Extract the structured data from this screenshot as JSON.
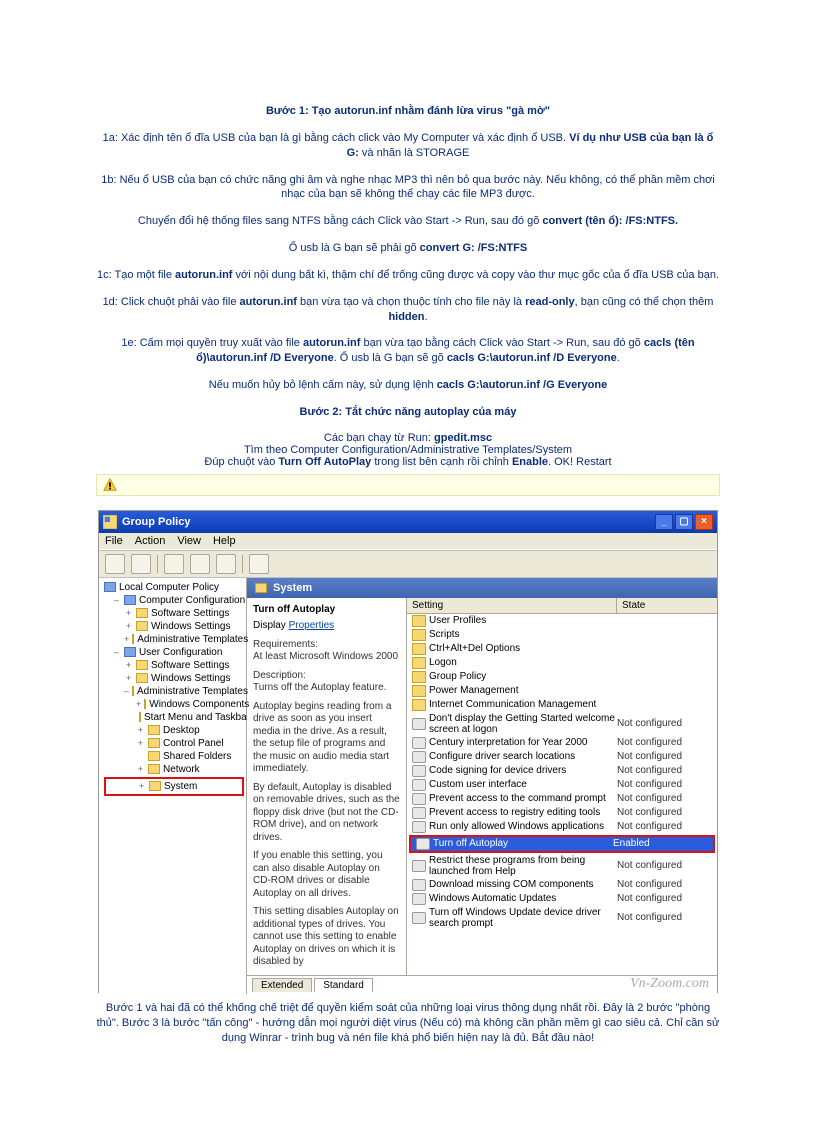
{
  "step1": {
    "heading": "Bước 1: Tạo autorun.inf nhằm đánh lừa virus \"gà mờ\"",
    "p1a_pre": "1a: Xác định tên ổ đĩa USB của bạn là gì bằng cách click vào My Computer và xác định ổ USB. ",
    "p1a_bold1": "Ví dụ như USB của bạn là ổ G:",
    "p1a_post": " và nhãn là STORAGE",
    "p1b": "1b: Nếu ổ USB của bạn có chức năng ghi âm và nghe nhạc MP3 thì nên bỏ qua bước này. Nếu không, có thể phần mềm chơi nhạc của bạn sẽ không thể chạy các file MP3 được.",
    "p1conv_pre": "Chuyển đổi hệ thống files sang NTFS bằng cách Click vào Start -> Run, sau đó gõ ",
    "p1conv_bold": "convert (tên ổ): /FS:NTFS.",
    "p1g_pre": "Ổ usb là G bạn sẽ phải gõ ",
    "p1g_bold": "convert G: /FS:NTFS",
    "p1c_pre": "1c: Tạo một file ",
    "p1c_b1": "autorun.inf",
    "p1c_mid": " với nội dung bất kì, thậm chí để trống cũng được và copy vào thư mục gốc của ổ đĩa USB của bạn.",
    "p1d_pre": "1d: Click chuột phải vào file ",
    "p1d_b1": "autorun.inf",
    "p1d_mid": " bạn vừa tạo và chọn thuộc tính cho file này là ",
    "p1d_b2": "read-only",
    "p1d_mid2": ", bạn cũng có thể chọn thêm ",
    "p1d_b3": "hidden",
    "p1e_pre": "1e: Cấm mọi quyền truy xuất vào file ",
    "p1e_b1": "autorun.inf",
    "p1e_mid": " bạn vừa tạo bằng cách Click vào Start -> Run, sau đó gõ ",
    "p1e_b2": "cacls (tên ổ)\\autorun.inf /D Everyone",
    "p1e_mid2": ". Ổ usb là G bạn sẽ gõ ",
    "p1e_b3": "cacls G:\\autorun.inf /D Everyone",
    "p1undo_pre": "Nếu muốn hủy bỏ lệnh cấm này, sử dụng lệnh ",
    "p1undo_b": "cacls G:\\autorun.inf /G Everyone"
  },
  "step2": {
    "heading": "Bước 2: Tắt chức năng autoplay của máy",
    "run_pre": "Các bạn chạy từ Run: ",
    "run_b": "gpedit.msc",
    "path": "Tìm theo Computer Configuration/Administrative Templates/System",
    "dbl_pre": "Đúp chuột vào ",
    "dbl_b": "Turn Off AutoPlay",
    "dbl_mid": " trong list bên cạnh rồi chỉnh ",
    "dbl_b2": "Enable",
    "dbl_post": ". OK! Restart"
  },
  "gp": {
    "title": "Group Policy",
    "menu": {
      "file": "File",
      "action": "Action",
      "view": "View",
      "help": "Help"
    },
    "tree": {
      "root": "Local Computer Policy",
      "cc": "Computer Configuration",
      "ss": "Software Settings",
      "ws": "Windows Settings",
      "at": "Administrative Templates",
      "uc": "User Configuration",
      "wc": "Windows Components",
      "smt": "Start Menu and Taskba",
      "dk": "Desktop",
      "cp": "Control Panel",
      "sf": "Shared Folders",
      "nw": "Network",
      "sys": "System"
    },
    "header": "System",
    "detail": {
      "title": "Turn off Autoplay",
      "link": "Properties",
      "req_lbl": "Requirements:",
      "req_val": "At least Microsoft Windows 2000",
      "desc_lbl": "Description:",
      "desc_val": "Turns off the Autoplay feature.",
      "p1": "Autoplay begins reading from a drive as soon as you insert media in the drive. As a result, the setup file of programs and the music on audio media start immediately.",
      "p2": "By default, Autoplay is disabled on removable drives, such as the floppy disk drive (but not the CD-ROM drive), and on network drives.",
      "p3": "If you enable this setting, you can also disable Autoplay on CD-ROM drives or disable Autoplay on all drives.",
      "p4": "This setting disables Autoplay on additional types of drives. You cannot use this setting to enable Autoplay on drives on which it is disabled by"
    },
    "cols": {
      "setting": "Setting",
      "state": "State"
    },
    "rows": [
      {
        "t": "f",
        "name": "User Profiles",
        "state": ""
      },
      {
        "t": "f",
        "name": "Scripts",
        "state": ""
      },
      {
        "t": "f",
        "name": "Ctrl+Alt+Del Options",
        "state": ""
      },
      {
        "t": "f",
        "name": "Logon",
        "state": ""
      },
      {
        "t": "f",
        "name": "Group Policy",
        "state": ""
      },
      {
        "t": "f",
        "name": "Power Management",
        "state": ""
      },
      {
        "t": "f",
        "name": "Internet Communication Management",
        "state": ""
      },
      {
        "t": "s",
        "name": "Don't display the Getting Started welcome screen at logon",
        "state": "Not configured"
      },
      {
        "t": "s",
        "name": "Century interpretation for Year 2000",
        "state": "Not configured"
      },
      {
        "t": "s",
        "name": "Configure driver search locations",
        "state": "Not configured"
      },
      {
        "t": "s",
        "name": "Code signing for device drivers",
        "state": "Not configured"
      },
      {
        "t": "s",
        "name": "Custom user interface",
        "state": "Not configured"
      },
      {
        "t": "s",
        "name": "Prevent access to the command prompt",
        "state": "Not configured"
      },
      {
        "t": "s",
        "name": "Prevent access to registry editing tools",
        "state": "Not configured"
      },
      {
        "t": "s",
        "name": "Run only allowed Windows applications",
        "state": "Not configured"
      },
      {
        "t": "s",
        "name": "Turn off Autoplay",
        "state": "Enabled",
        "sel": true,
        "hl": true
      },
      {
        "t": "s",
        "name": "Restrict these programs from being launched from Help",
        "state": "Not configured"
      },
      {
        "t": "s",
        "name": "Download missing COM components",
        "state": "Not configured"
      },
      {
        "t": "s",
        "name": "Windows Automatic Updates",
        "state": "Not configured"
      },
      {
        "t": "s",
        "name": "Turn off Windows Update device driver search prompt",
        "state": "Not configured"
      }
    ],
    "tabs": {
      "ext": "Extended",
      "std": "Standard"
    }
  },
  "bottom": "Bước 1 và hai đã có thể khống chế triệt để quyền kiểm soát của những loại virus thông dụng nhất rồi. Đây là 2 bước \"phòng thủ\". Bước 3 là bước \"tấn công\" - hướng dẫn mọi người diệt virus (Nếu có) mà không cần phần mềm gì cao siêu cả. Chỉ cần sử dụng Winrar - trình bug và nén file khá phổ biến hiện nay là đủ. Bắt đầu nào!"
}
